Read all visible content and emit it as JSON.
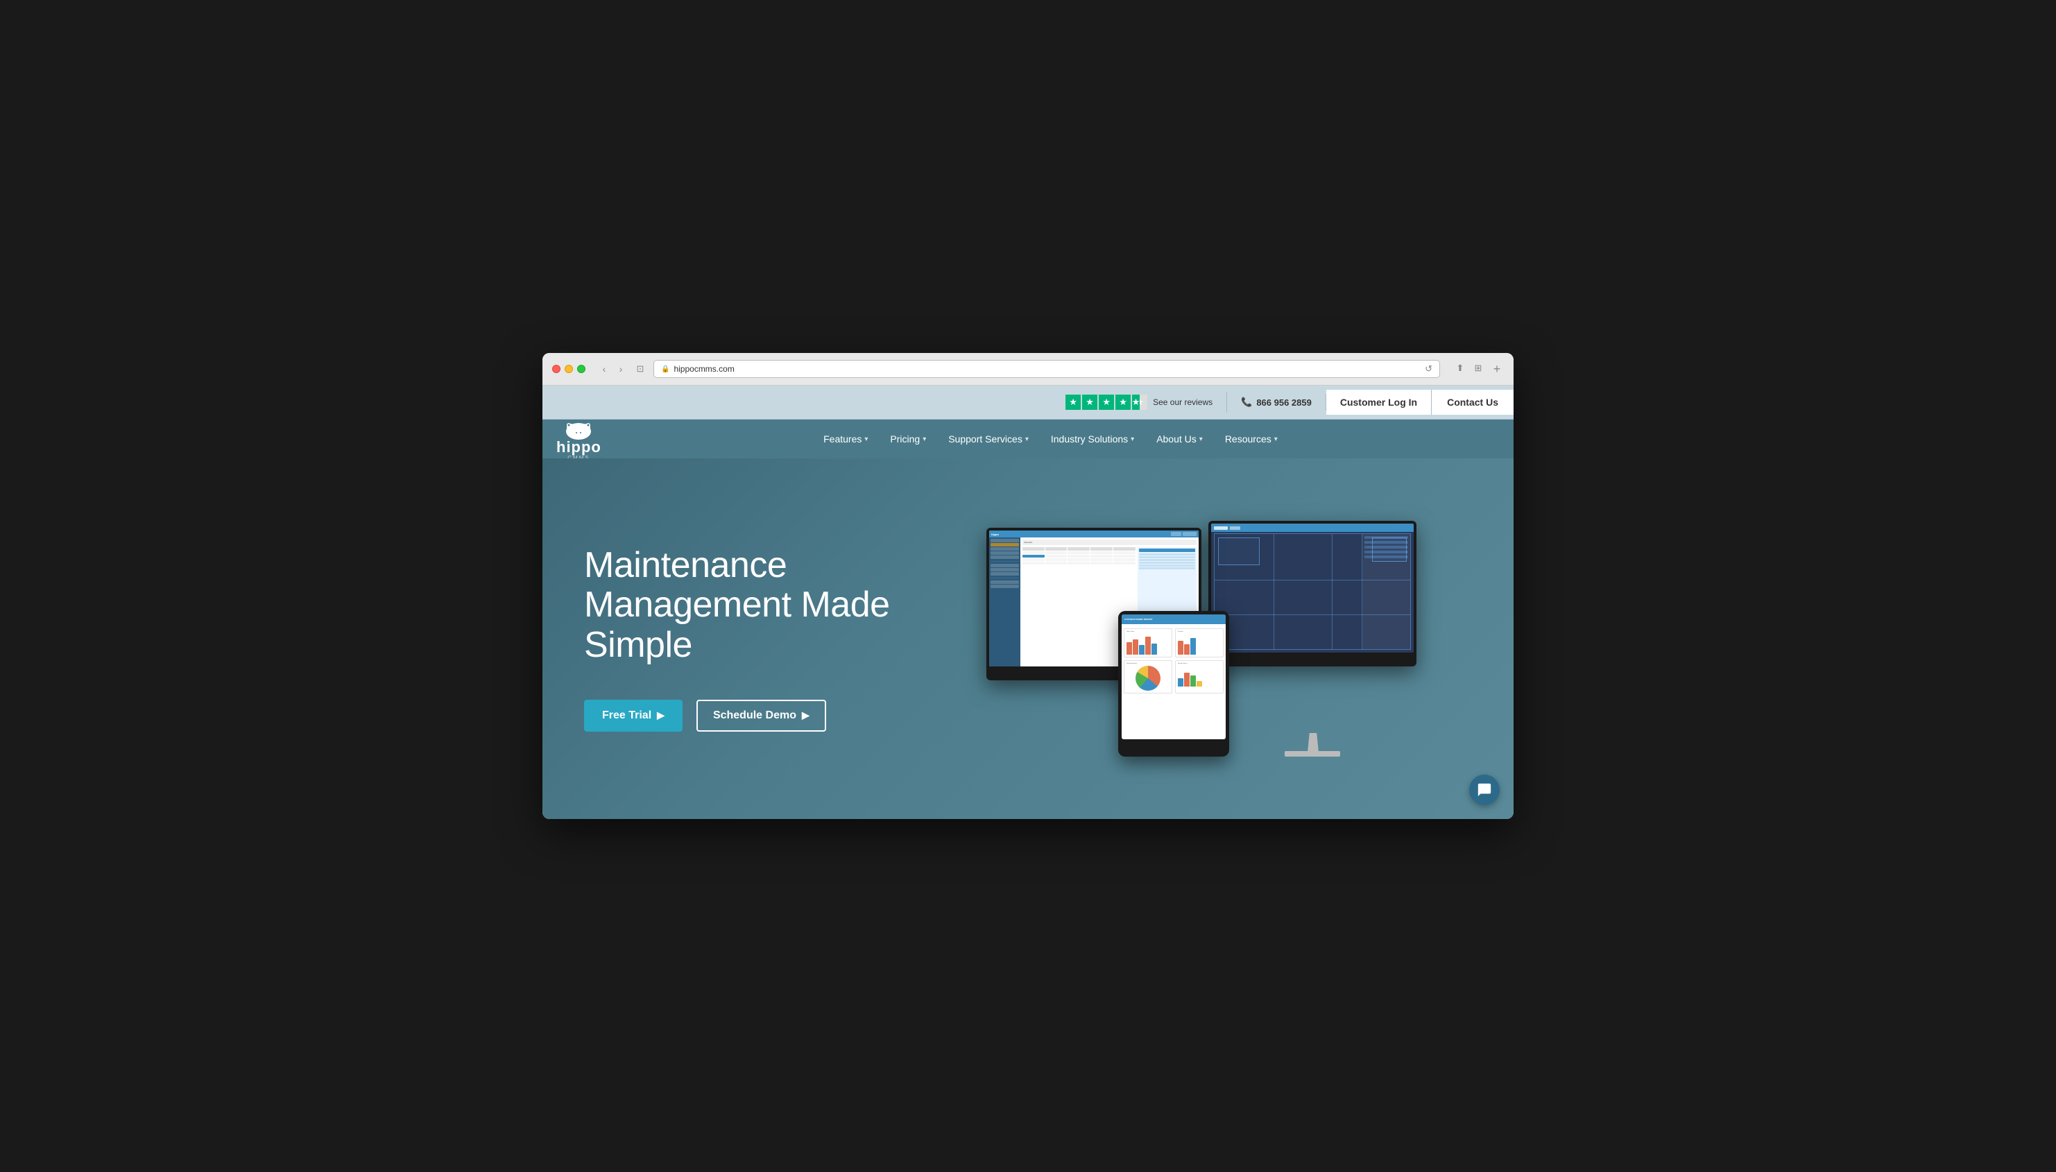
{
  "browser": {
    "url": "hippocmms.com",
    "url_display": "hippocmms.com"
  },
  "topbar": {
    "reviews_text": "See our reviews",
    "phone": "866 956 2859",
    "customer_login": "Customer Log In",
    "contact_us": "Contact Us"
  },
  "nav": {
    "logo_text": "hippo",
    "logo_sub": "CMMS",
    "items": [
      {
        "label": "Features",
        "has_dropdown": true
      },
      {
        "label": "Pricing",
        "has_dropdown": true
      },
      {
        "label": "Support Services",
        "has_dropdown": true
      },
      {
        "label": "Industry Solutions",
        "has_dropdown": true
      },
      {
        "label": "About Us",
        "has_dropdown": true
      },
      {
        "label": "Resources",
        "has_dropdown": true
      }
    ]
  },
  "hero": {
    "title": "Maintenance Management Made Simple",
    "btn_free_trial": "Free Trial",
    "btn_schedule_demo": "Schedule Demo"
  },
  "colors": {
    "hero_bg": "#4d7d8d",
    "nav_bg": "#4a7a8a",
    "btn_trial": "#29a8c4",
    "customer_login_bg": "#ffffff",
    "contact_us_bg": "#ffffff"
  }
}
